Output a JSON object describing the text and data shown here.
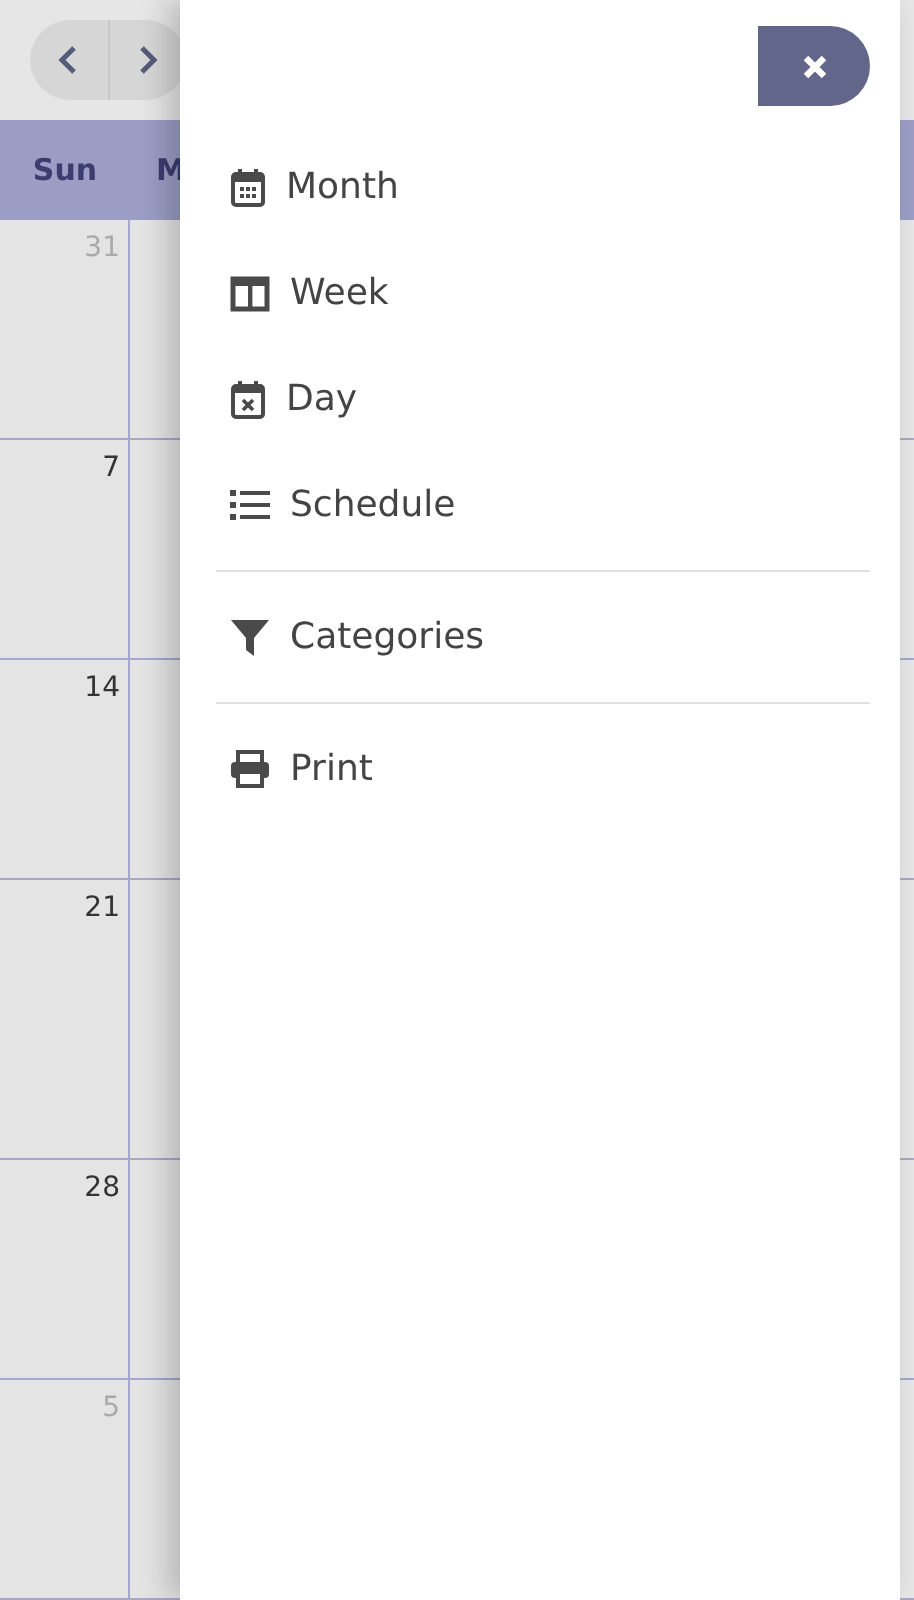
{
  "calendar": {
    "weekday_headers": [
      "Sun",
      "M"
    ],
    "weeks": [
      {
        "day": "31",
        "other_month": true
      },
      {
        "day": "7",
        "other_month": false
      },
      {
        "day": "14",
        "other_month": false
      },
      {
        "day": "21",
        "other_month": false
      },
      {
        "day": "28",
        "other_month": false
      },
      {
        "day": "5",
        "other_month": true
      }
    ]
  },
  "drawer": {
    "menu_sections": [
      {
        "items": [
          {
            "label": "Month"
          },
          {
            "label": "Week"
          },
          {
            "label": "Day"
          },
          {
            "label": "Schedule"
          }
        ]
      },
      {
        "items": [
          {
            "label": "Categories"
          }
        ]
      },
      {
        "items": [
          {
            "label": "Print"
          }
        ]
      }
    ]
  }
}
